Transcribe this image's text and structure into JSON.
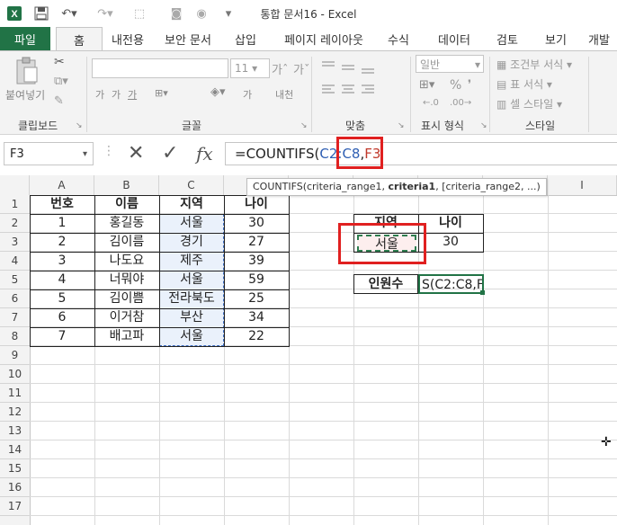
{
  "window": {
    "title": "통합 문서16 - Excel"
  },
  "ribbon": {
    "tabs": [
      "파일",
      "홈",
      "내전용",
      "보안 문서",
      "삽입",
      "페이지 레이아웃",
      "수식",
      "데이터",
      "검토",
      "보기",
      "개발"
    ],
    "groups": {
      "clipboard": "클립보드",
      "font": "글꼴",
      "align": "맞춤",
      "number": "표시 형식",
      "style": "스타일"
    },
    "paste_label": "붙여넣기",
    "font_size": "11",
    "number_format": "일반",
    "style_items": [
      "조건부 서식",
      "표 서식",
      "셀 스타일"
    ],
    "font_btns": [
      "가",
      "가",
      "가",
      "가",
      "가"
    ],
    "wrap_label": "내천",
    "percent": "%"
  },
  "formula_bar": {
    "name_box": "F3",
    "fx_symbol": "fx",
    "formula_prefix": "=COUNTIFS(",
    "formula_ref1": "C2:C8",
    "formula_comma": ",",
    "formula_ref2": "F3",
    "tooltip_pre": "COUNTIFS(criteria_range1, ",
    "tooltip_bold": "criteria1",
    "tooltip_post": ", [criteria_range2, ...)"
  },
  "grid": {
    "columns": [
      "A",
      "B",
      "C",
      "D",
      "E",
      "F",
      "G",
      "H",
      "I"
    ],
    "rows": [
      "1",
      "2",
      "3",
      "4",
      "5",
      "6",
      "7",
      "8",
      "9",
      "10",
      "11",
      "12",
      "13",
      "14",
      "15",
      "16",
      "17"
    ]
  },
  "table": {
    "headers": [
      "번호",
      "이름",
      "지역",
      "나이"
    ],
    "rows": [
      [
        "1",
        "홍길동",
        "서울",
        "30"
      ],
      [
        "2",
        "김이름",
        "경기",
        "27"
      ],
      [
        "3",
        "나도요",
        "제주",
        "39"
      ],
      [
        "4",
        "너뭐야",
        "서울",
        "59"
      ],
      [
        "5",
        "김이쁨",
        "전라북도",
        "25"
      ],
      [
        "6",
        "이거참",
        "부산",
        "34"
      ],
      [
        "7",
        "배고파",
        "서울",
        "22"
      ]
    ]
  },
  "criteria": {
    "headers": [
      "지역",
      "나이"
    ],
    "values": [
      "서울",
      "30"
    ],
    "count_label": "인원수",
    "count_cell": "S(C2:C8,F3"
  }
}
